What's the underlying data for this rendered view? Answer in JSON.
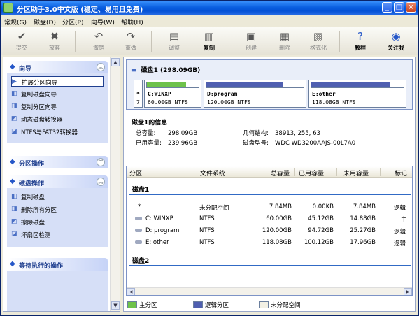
{
  "window": {
    "title": "分区助手3.0中文版 (稳定、易用且免费)"
  },
  "titlebar_buttons": {
    "minimize": "_",
    "maximize": "□",
    "close": "×"
  },
  "menu": [
    "常规(G)",
    "磁盘(D)",
    "分区(P)",
    "向导(W)",
    "帮助(H)"
  ],
  "toolbar": {
    "submit": "提交",
    "discard": "放弃",
    "undo": "撤销",
    "redo": "重做",
    "resize": "调整",
    "copy": "复制",
    "create": "创建",
    "delete": "删除",
    "format": "格式化",
    "tutorial": "教程",
    "follow": "关注我"
  },
  "sidebar": {
    "wizard": {
      "title": "向导",
      "items": [
        "扩展分区向导",
        "复制磁盘向导",
        "复制分区向导",
        "动态磁盘转换器",
        "NTFS与FAT32转换器"
      ]
    },
    "partition_ops": {
      "title": "分区操作"
    },
    "disk_ops": {
      "title": "磁盘操作",
      "items": [
        "复制磁盘",
        "删除所有分区",
        "擦除磁盘",
        "坏扇区检测"
      ]
    },
    "pending": {
      "title": "等待执行的操作"
    }
  },
  "disk_map": {
    "header": "磁盘1  (298.09GB)",
    "segments": [
      {
        "letter": "*",
        "num": "7",
        "type": "unallocated"
      },
      {
        "name": "C:WINXP",
        "size": "60.00GB NTFS",
        "used_fraction": 0.75,
        "color": "#6ec24a"
      },
      {
        "name": "D:program",
        "size": "120.00GB NTFS",
        "used_fraction": 0.79,
        "color": "#4f5fb0"
      },
      {
        "name": "E:other",
        "size": "118.08GB NTFS",
        "used_fraction": 0.85,
        "color": "#4f5fb0"
      }
    ]
  },
  "disk_info": {
    "title": "磁盘1的信息",
    "total_label": "总容量:",
    "total": "298.09GB",
    "used_label": "已用容量:",
    "used": "239.96GB",
    "geom_label": "几何结构:",
    "geom": "38913, 255, 63",
    "model_label": "磁盘型号:",
    "model": "WDC WD3200AAJS-00L7A0"
  },
  "table": {
    "headers": [
      "分区",
      "文件系统",
      "总容量",
      "已用容量",
      "未用容量",
      "标记"
    ],
    "group1": "磁盘1",
    "rows": [
      {
        "part": "*",
        "fs": "未分配空间",
        "total": "7.84MB",
        "used": "0.00KB",
        "free": "7.84MB",
        "flag": "逻辑"
      },
      {
        "part": "C: WINXP",
        "fs": "NTFS",
        "total": "60.00GB",
        "used": "45.12GB",
        "free": "14.88GB",
        "flag": "主"
      },
      {
        "part": "D: program",
        "fs": "NTFS",
        "total": "120.00GB",
        "used": "94.72GB",
        "free": "25.27GB",
        "flag": "逻辑"
      },
      {
        "part": "E: other",
        "fs": "NTFS",
        "total": "118.08GB",
        "used": "100.12GB",
        "free": "17.96GB",
        "flag": "逻辑"
      }
    ],
    "group2": "磁盘2"
  },
  "legend": {
    "primary": "主分区",
    "logical": "逻辑分区",
    "unallocated": "未分配空间",
    "primary_color": "#6ec24a",
    "logical_color": "#4f5fb0",
    "unallocated_color": "#f2f0e4"
  }
}
